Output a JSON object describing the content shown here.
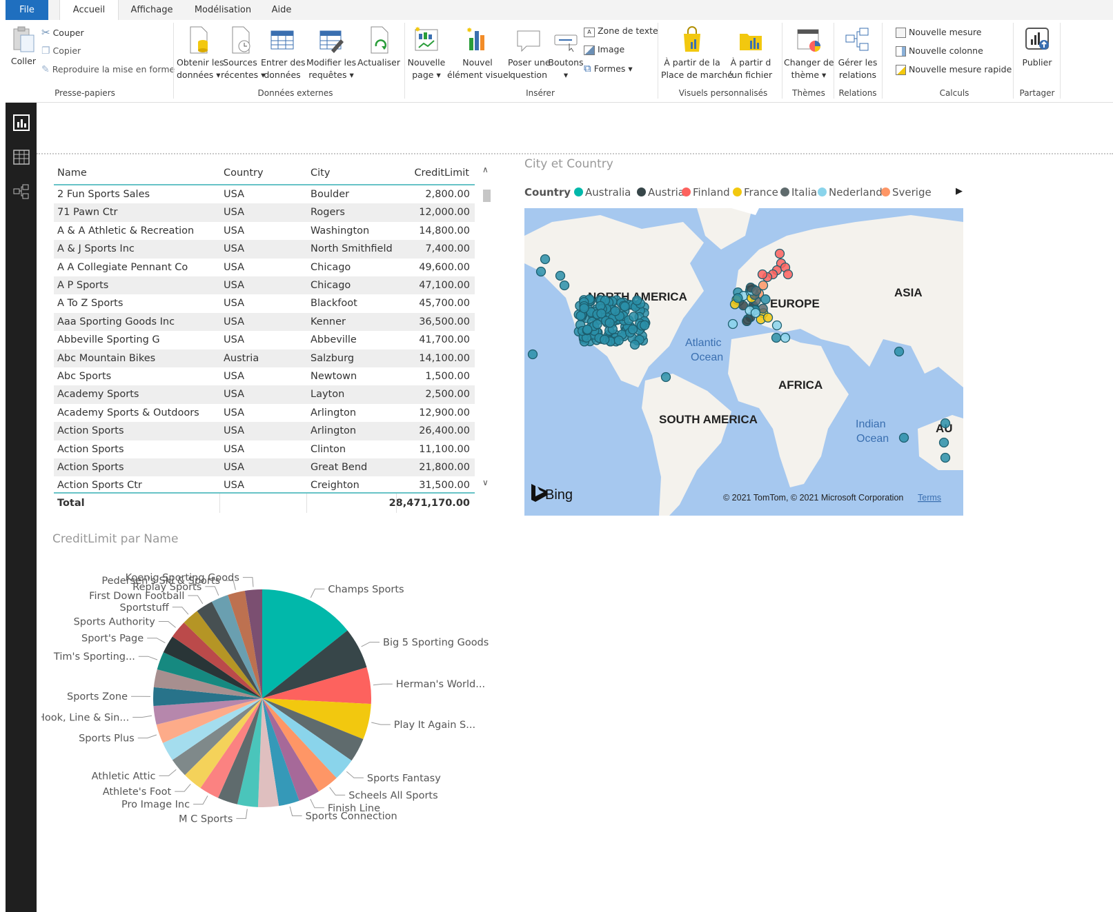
{
  "tabs": [
    {
      "label": "File"
    },
    {
      "label": "Accueil"
    },
    {
      "label": "Affichage"
    },
    {
      "label": "Modélisation"
    },
    {
      "label": "Aide"
    }
  ],
  "ribbon": {
    "clipboard": {
      "paste": "Coller",
      "cut": "Couper",
      "copy": "Copier",
      "format_painter": "Reproduire la mise en forme",
      "group": "Presse-papiers"
    },
    "external": {
      "get_data_1": "Obtenir les",
      "get_data_2": "données",
      "recent_1": "Sources",
      "recent_2": "récentes",
      "enter_1": "Entrer des",
      "enter_2": "données",
      "edit_1": "Modifier les",
      "edit_2": "requêtes",
      "refresh": "Actualiser",
      "group": "Données externes"
    },
    "insert": {
      "new_page_1": "Nouvelle",
      "new_page_2": "page",
      "new_visual_1": "Nouvel",
      "new_visual_2": "élément visuel",
      "qa_1": "Poser une",
      "qa_2": "question",
      "buttons": "Boutons",
      "textbox": "Zone de texte",
      "image": "Image",
      "shapes": "Formes",
      "group": "Insérer"
    },
    "custom": {
      "market_1": "À partir de la",
      "market_2": "Place de marché",
      "file_1": "À partir d",
      "file_2": "'un fichier",
      "group": "Visuels personnalisés"
    },
    "themes": {
      "change_1": "Changer de",
      "change_2": "thème",
      "group": "Thèmes"
    },
    "relations": {
      "manage_1": "Gérer les",
      "manage_2": "relations",
      "group": "Relations"
    },
    "calc": {
      "new_measure": "Nouvelle mesure",
      "new_column": "Nouvelle colonne",
      "quick_measure": "Nouvelle mesure rapide",
      "group": "Calculs"
    },
    "share": {
      "publish": "Publier",
      "group": "Partager"
    }
  },
  "table": {
    "headers": [
      "Name",
      "Country",
      "City",
      "CreditLimit"
    ],
    "rows": [
      [
        "2 Fun Sports Sales",
        "USA",
        "Boulder",
        "2,800.00"
      ],
      [
        "71 Pawn Ctr",
        "USA",
        "Rogers",
        "12,000.00"
      ],
      [
        "A & A Athletic & Recreation",
        "USA",
        "Washington",
        "14,800.00"
      ],
      [
        "A & J Sports Inc",
        "USA",
        "North Smithfield",
        "7,400.00"
      ],
      [
        "A A Collegiate Pennant Co",
        "USA",
        "Chicago",
        "49,600.00"
      ],
      [
        "A P Sports",
        "USA",
        "Chicago",
        "47,100.00"
      ],
      [
        "A To Z Sports",
        "USA",
        "Blackfoot",
        "45,700.00"
      ],
      [
        "Aaa Sporting Goods Inc",
        "USA",
        "Kenner",
        "36,500.00"
      ],
      [
        "Abbeville Sporting G",
        "USA",
        "Abbeville",
        "41,700.00"
      ],
      [
        "Abc Mountain Bikes",
        "Austria",
        "Salzburg",
        "14,100.00"
      ],
      [
        "Abc Sports",
        "USA",
        "Newtown",
        "1,500.00"
      ],
      [
        "Academy Sports",
        "USA",
        "Layton",
        "2,500.00"
      ],
      [
        "Academy Sports & Outdoors",
        "USA",
        "Arlington",
        "12,900.00"
      ],
      [
        "Action Sports",
        "USA",
        "Arlington",
        "26,400.00"
      ],
      [
        "Action Sports",
        "USA",
        "Clinton",
        "11,100.00"
      ],
      [
        "Action Sports",
        "USA",
        "Great Bend",
        "21,800.00"
      ],
      [
        "Action Sports Ctr",
        "USA",
        "Creighton",
        "31,500.00"
      ]
    ],
    "total_label": "Total",
    "total_value": "28,471,170.00"
  },
  "map": {
    "title": "City et Country",
    "legend_title": "Country",
    "legend": [
      {
        "name": "Australia",
        "color": "#01b8aa"
      },
      {
        "name": "Austria",
        "color": "#374649"
      },
      {
        "name": "Finland",
        "color": "#fd625e"
      },
      {
        "name": "France",
        "color": "#f2c80f"
      },
      {
        "name": "Italia",
        "color": "#5f6b6d"
      },
      {
        "name": "Nederland",
        "color": "#8ad4eb"
      },
      {
        "name": "Sverige",
        "color": "#fe9666"
      }
    ],
    "labels": {
      "north_america": "NORTH AMERICA",
      "europe": "EUROPE",
      "asia": "ASIA",
      "africa": "AFRICA",
      "south_america": "SOUTH AMERICA",
      "atlantic_1": "Atlantic",
      "atlantic_2": "Ocean",
      "indian_1": "Indian",
      "indian_2": "Ocean",
      "australia_partial": "AU"
    },
    "brand": "Bing",
    "copyright": "© 2021 TomTom, © 2021 Microsoft Corporation",
    "terms": "Terms"
  },
  "chart_data": {
    "type": "pie",
    "title": "CreditLimit par Name",
    "slices": [
      {
        "label": "Champs Sports",
        "value": 14.0,
        "color": "#01b8aa"
      },
      {
        "label": "Big 5 Sporting Goods",
        "value": 6.0,
        "color": "#374649"
      },
      {
        "label": "Herman's World...",
        "value": 5.3,
        "color": "#fd625e"
      },
      {
        "label": "Play It Again S...",
        "value": 5.2,
        "color": "#f2c80f"
      },
      {
        "label": "",
        "value": 3.5,
        "color": "#5f6b6d"
      },
      {
        "label": "Sports Fantasy",
        "value": 3.3,
        "color": "#8ad4eb"
      },
      {
        "label": "Scheels All Sports",
        "value": 3.2,
        "color": "#fe9666"
      },
      {
        "label": "Finish Line",
        "value": 3.1,
        "color": "#a66999"
      },
      {
        "label": "Sports Connection",
        "value": 3.0,
        "color": "#3599b8"
      },
      {
        "label": "",
        "value": 3.0,
        "color": "#dfbfbf"
      },
      {
        "label": "M C Sports",
        "value": 3.0,
        "color": "#4ac5bb"
      },
      {
        "label": "",
        "value": 2.9,
        "color": "#5f6b6d"
      },
      {
        "label": "Pro Image Inc",
        "value": 2.9,
        "color": "#fb8281"
      },
      {
        "label": "Athlete's Foot",
        "value": 2.9,
        "color": "#f4d25a"
      },
      {
        "label": "Athletic Attic",
        "value": 2.8,
        "color": "#7f898a"
      },
      {
        "label": "",
        "value": 2.8,
        "color": "#a4ddee"
      },
      {
        "label": "Sports Plus",
        "value": 2.8,
        "color": "#fdab89"
      },
      {
        "label": "Hook, Line & Sin...",
        "value": 2.7,
        "color": "#b687ac"
      },
      {
        "label": "Sports Zone",
        "value": 2.7,
        "color": "#28738a"
      },
      {
        "label": "",
        "value": 2.6,
        "color": "#a78f8f"
      },
      {
        "label": "Tim's Sporting...",
        "value": 2.6,
        "color": "#168980"
      },
      {
        "label": "Sport's Page",
        "value": 2.6,
        "color": "#293537"
      },
      {
        "label": "Sports Authority",
        "value": 2.6,
        "color": "#bb4a4a"
      },
      {
        "label": "Sportstuff",
        "value": 2.5,
        "color": "#b59525"
      },
      {
        "label": "First Down Football",
        "value": 2.5,
        "color": "#475052"
      },
      {
        "label": "Replay Sports",
        "value": 2.5,
        "color": "#6a9fb0"
      },
      {
        "label": "Pedersen's Ski & Sports",
        "value": 2.5,
        "color": "#bd7150"
      },
      {
        "label": "Koenig Sporting Goods",
        "value": 2.5,
        "color": "#7b4f71"
      }
    ]
  }
}
